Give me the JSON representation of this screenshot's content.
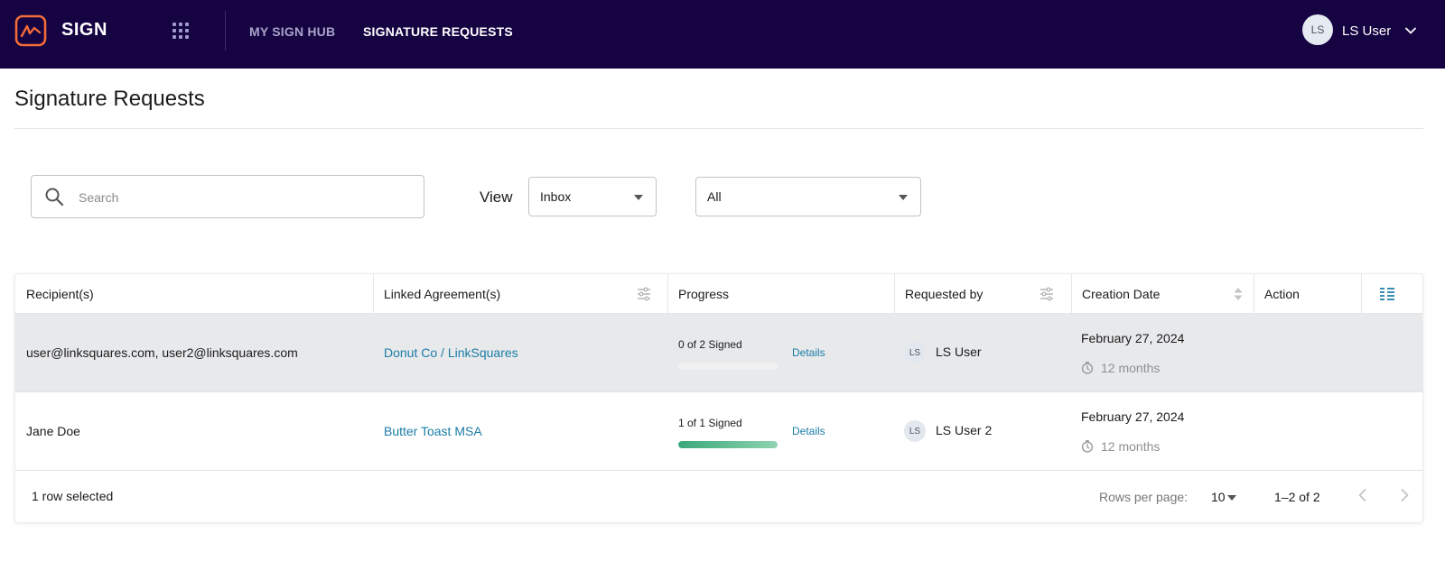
{
  "header": {
    "brand": "SIGN",
    "nav": [
      {
        "label": "MY SIGN HUB",
        "active": false
      },
      {
        "label": "SIGNATURE REQUESTS",
        "active": true
      }
    ],
    "user": {
      "initials": "LS",
      "name": "LS User"
    },
    "colors": {
      "bar": "#150342",
      "logo": "#f26b3a"
    }
  },
  "page": {
    "title": "Signature Requests"
  },
  "filters": {
    "search_placeholder": "Search",
    "view_label": "View",
    "view_value": "Inbox",
    "status_value": "All"
  },
  "table": {
    "columns": [
      "Recipient(s)",
      "Linked Agreement(s)",
      "Progress",
      "Requested by",
      "Creation Date",
      "Action"
    ],
    "rows": [
      {
        "recipients": "user@linksquares.com, user2@linksquares.com",
        "agreement": "Donut Co / LinkSquares",
        "progress_text": "0 of 2 Signed",
        "progress_fraction": 0,
        "details": "Details",
        "requester_initials": "LS",
        "requester": "LS User",
        "date": "February 27, 2024",
        "ago": "12 months",
        "selected": true
      },
      {
        "recipients": "Jane Doe",
        "agreement": "Butter Toast MSA",
        "progress_text": "1 of 1 Signed",
        "progress_fraction": 1,
        "details": "Details",
        "requester_initials": "LS",
        "requester": "LS User 2",
        "date": "February 27, 2024",
        "ago": "12 months",
        "selected": false
      }
    ],
    "footer": {
      "selection": "1 row selected",
      "rows_per_page_label": "Rows per page:",
      "rows_per_page": "10",
      "range": "1–2 of 2"
    },
    "colors": {
      "link": "#1b7da8",
      "progress": "#3aa87a",
      "selected_row": "#e8e9eb"
    }
  },
  "icons": [
    "logo-icon",
    "apps-grid-icon",
    "chevron-down-icon",
    "search-icon",
    "filter-icon",
    "sort-icon",
    "columns-icon",
    "clock-icon",
    "chevron-left-icon",
    "chevron-right-icon"
  ]
}
